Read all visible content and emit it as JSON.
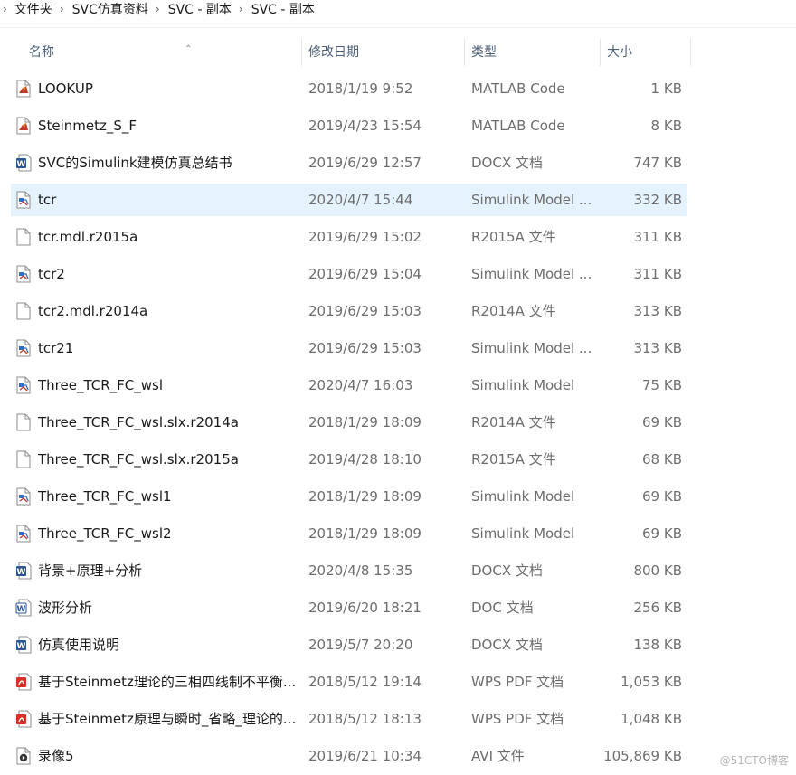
{
  "breadcrumb": [
    "文件夹",
    "SVC仿真资料",
    "SVC - 副本",
    "SVC - 副本"
  ],
  "columns": {
    "name": "名称",
    "date": "修改日期",
    "type": "类型",
    "size": "大小"
  },
  "files": [
    {
      "name": "LOOKUP",
      "date": "2018/1/19 9:52",
      "type": "MATLAB Code",
      "size": "1 KB",
      "icon": "matlab-code-icon",
      "selected": false
    },
    {
      "name": "Steinmetz_S_F",
      "date": "2019/4/23 15:54",
      "type": "MATLAB Code",
      "size": "8 KB",
      "icon": "matlab-code-icon",
      "selected": false
    },
    {
      "name": "SVC的Simulink建模仿真总结书",
      "date": "2019/6/29 12:57",
      "type": "DOCX 文档",
      "size": "747 KB",
      "icon": "word-doc-icon",
      "selected": false
    },
    {
      "name": "tcr",
      "date": "2020/4/7 15:44",
      "type": "Simulink Model ...",
      "size": "332 KB",
      "icon": "simulink-model-icon",
      "selected": true
    },
    {
      "name": "tcr.mdl.r2015a",
      "date": "2019/6/29 15:02",
      "type": "R2015A 文件",
      "size": "311 KB",
      "icon": "blank-file-icon",
      "selected": false
    },
    {
      "name": "tcr2",
      "date": "2019/6/29 15:04",
      "type": "Simulink Model ...",
      "size": "311 KB",
      "icon": "simulink-model-icon",
      "selected": false
    },
    {
      "name": "tcr2.mdl.r2014a",
      "date": "2019/6/29 15:03",
      "type": "R2014A 文件",
      "size": "313 KB",
      "icon": "blank-file-icon",
      "selected": false
    },
    {
      "name": "tcr21",
      "date": "2019/6/29 15:03",
      "type": "Simulink Model ...",
      "size": "313 KB",
      "icon": "simulink-model-icon",
      "selected": false
    },
    {
      "name": "Three_TCR_FC_wsl",
      "date": "2020/4/7 16:03",
      "type": "Simulink Model",
      "size": "75 KB",
      "icon": "simulink-model-icon",
      "selected": false
    },
    {
      "name": "Three_TCR_FC_wsl.slx.r2014a",
      "date": "2018/1/29 18:09",
      "type": "R2014A 文件",
      "size": "69 KB",
      "icon": "blank-file-icon",
      "selected": false
    },
    {
      "name": "Three_TCR_FC_wsl.slx.r2015a",
      "date": "2019/4/28 18:10",
      "type": "R2015A 文件",
      "size": "68 KB",
      "icon": "blank-file-icon",
      "selected": false
    },
    {
      "name": "Three_TCR_FC_wsl1",
      "date": "2018/1/29 18:09",
      "type": "Simulink Model",
      "size": "69 KB",
      "icon": "simulink-model-icon",
      "selected": false
    },
    {
      "name": "Three_TCR_FC_wsl2",
      "date": "2018/1/29 18:09",
      "type": "Simulink Model",
      "size": "69 KB",
      "icon": "simulink-model-icon",
      "selected": false
    },
    {
      "name": "背景+原理+分析",
      "date": "2020/4/8 15:35",
      "type": "DOCX 文档",
      "size": "800 KB",
      "icon": "word-doc-icon",
      "selected": false
    },
    {
      "name": "波形分析",
      "date": "2019/6/20 18:21",
      "type": "DOC 文档",
      "size": "256 KB",
      "icon": "word-doc-old-icon",
      "selected": false
    },
    {
      "name": "仿真使用说明",
      "date": "2019/5/7 20:20",
      "type": "DOCX 文档",
      "size": "138 KB",
      "icon": "word-doc-icon",
      "selected": false
    },
    {
      "name": "基于Steinmetz理论的三相四线制不平衡...",
      "date": "2018/5/12 19:14",
      "type": "WPS PDF 文档",
      "size": "1,053 KB",
      "icon": "pdf-icon",
      "selected": false
    },
    {
      "name": "基于Steinmetz原理与瞬时_省略_理论的...",
      "date": "2018/5/12 18:13",
      "type": "WPS PDF 文档",
      "size": "1,048 KB",
      "icon": "pdf-icon",
      "selected": false
    },
    {
      "name": "录像5",
      "date": "2019/6/21 10:34",
      "type": "AVI 文件",
      "size": "105,869 KB",
      "icon": "video-file-icon",
      "selected": false
    }
  ],
  "watermark": "@51CTO博客",
  "colors": {
    "selected_row": "#e5f3ff",
    "header_text": "#4c607a",
    "word_blue": "#2b5797",
    "pdf_red": "#d93025"
  }
}
